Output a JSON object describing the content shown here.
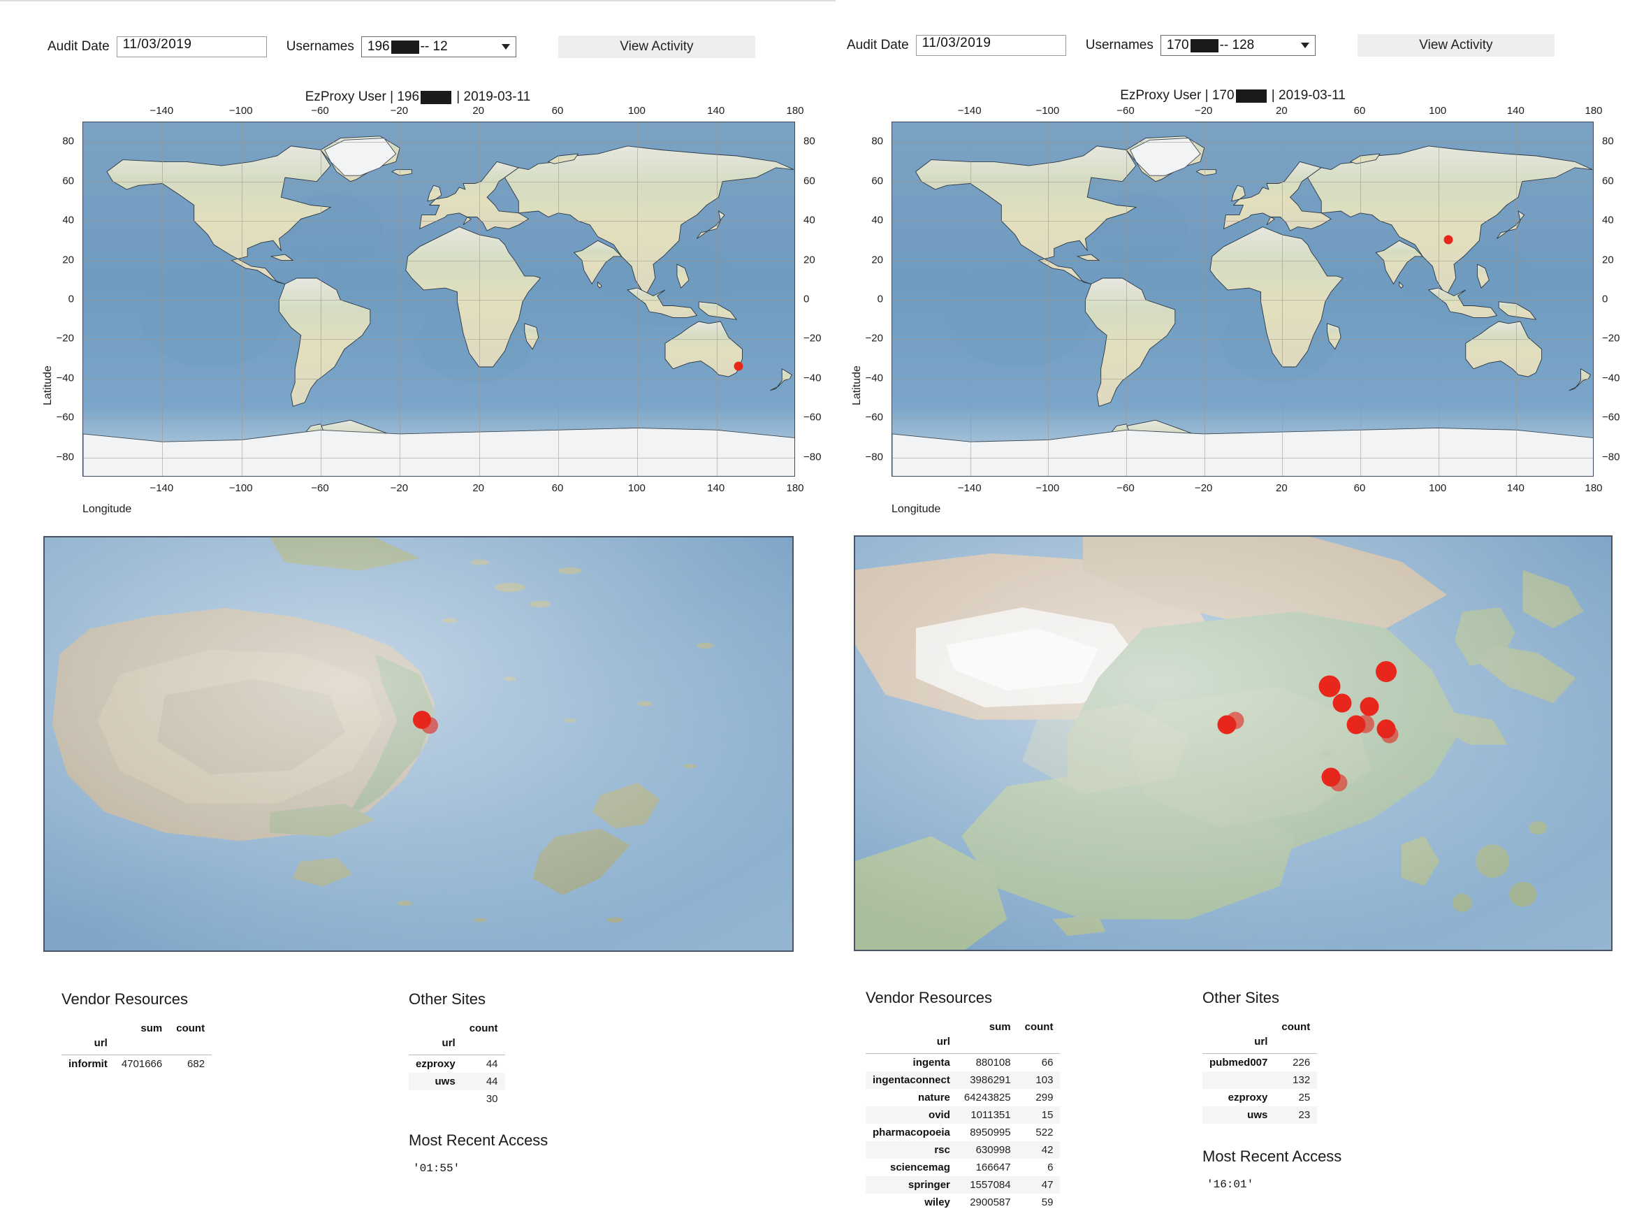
{
  "panels": [
    {
      "id": "left",
      "controls": {
        "audit_date_label": "Audit Date",
        "audit_date_value": "11/03/2019",
        "usernames_label": "Usernames",
        "username_prefix": "196",
        "username_suffix": " -- 12",
        "view_activity_label": "View Activity"
      },
      "plot_title": {
        "prefix": "EzProxy User | 196",
        "suffix": " | 2019-03-11"
      },
      "axes": {
        "xlabel": "Longitude",
        "ylabel": "Latitude",
        "xticks": [
          -140,
          -100,
          -60,
          -20,
          20,
          60,
          100,
          140,
          180
        ],
        "yticks": [
          80,
          60,
          40,
          20,
          0,
          -20,
          -40,
          -60,
          -80
        ],
        "xlim": [
          -180,
          180
        ],
        "ylim": [
          -90,
          90
        ]
      },
      "world_markers": [
        {
          "lon": 151.2,
          "lat": -33.8,
          "size": 13
        }
      ],
      "detail_markers": [
        {
          "x": 0.503,
          "y": 0.438,
          "size": 26,
          "soft": false
        },
        {
          "x": 0.513,
          "y": 0.452,
          "size": 24,
          "soft": true
        }
      ],
      "vendor": {
        "title": "Vendor Resources",
        "index_name": "url",
        "columns": [
          "sum",
          "count"
        ],
        "rows": [
          {
            "url": "informit",
            "sum": "4701666",
            "count": "682"
          }
        ]
      },
      "other": {
        "title": "Other Sites",
        "index_name": "url",
        "columns": [
          "count"
        ],
        "rows": [
          {
            "url": "ezproxy",
            "count": "44"
          },
          {
            "url": "uws",
            "count": "44"
          },
          {
            "url": "",
            "count": "30"
          }
        ]
      },
      "recent": {
        "title": "Most Recent Access",
        "value": "'01:55'"
      }
    },
    {
      "id": "right",
      "controls": {
        "audit_date_label": "Audit Date",
        "audit_date_value": "11/03/2019",
        "usernames_label": "Usernames",
        "username_prefix": "170",
        "username_suffix": " -- 128",
        "view_activity_label": "View Activity"
      },
      "plot_title": {
        "prefix": "EzProxy User | 170",
        "suffix": " | 2019-03-11"
      },
      "axes": {
        "xlabel": "Longitude",
        "ylabel": "Latitude",
        "xticks": [
          -140,
          -100,
          -60,
          -20,
          20,
          60,
          100,
          140,
          180
        ],
        "yticks": [
          80,
          60,
          40,
          20,
          0,
          -20,
          -40,
          -60,
          -80
        ],
        "xlim": [
          -180,
          180
        ],
        "ylim": [
          -90,
          90
        ]
      },
      "world_markers": [
        {
          "lon": 105.0,
          "lat": 30.5,
          "size": 13
        }
      ],
      "detail_markers": [
        {
          "x": 0.7,
          "y": 0.325,
          "size": 30,
          "soft": false
        },
        {
          "x": 0.625,
          "y": 0.36,
          "size": 31,
          "soft": false
        },
        {
          "x": 0.642,
          "y": 0.4,
          "size": 27,
          "soft": false
        },
        {
          "x": 0.678,
          "y": 0.408,
          "size": 27,
          "soft": false
        },
        {
          "x": 0.66,
          "y": 0.452,
          "size": 27,
          "soft": false
        },
        {
          "x": 0.672,
          "y": 0.45,
          "size": 26,
          "soft": true
        },
        {
          "x": 0.7,
          "y": 0.462,
          "size": 27,
          "soft": false
        },
        {
          "x": 0.704,
          "y": 0.476,
          "size": 25,
          "soft": true
        },
        {
          "x": 0.49,
          "y": 0.452,
          "size": 27,
          "soft": false
        },
        {
          "x": 0.501,
          "y": 0.442,
          "size": 25,
          "soft": true
        },
        {
          "x": 0.627,
          "y": 0.578,
          "size": 27,
          "soft": false
        },
        {
          "x": 0.637,
          "y": 0.592,
          "size": 25,
          "soft": true
        }
      ],
      "vendor": {
        "title": "Vendor Resources",
        "index_name": "url",
        "columns": [
          "sum",
          "count"
        ],
        "rows": [
          {
            "url": "ingenta",
            "sum": "880108",
            "count": "66"
          },
          {
            "url": "ingentaconnect",
            "sum": "3986291",
            "count": "103"
          },
          {
            "url": "nature",
            "sum": "64243825",
            "count": "299"
          },
          {
            "url": "ovid",
            "sum": "1011351",
            "count": "15"
          },
          {
            "url": "pharmacopoeia",
            "sum": "8950995",
            "count": "522"
          },
          {
            "url": "rsc",
            "sum": "630998",
            "count": "42"
          },
          {
            "url": "sciencemag",
            "sum": "166647",
            "count": "6"
          },
          {
            "url": "springer",
            "sum": "1557084",
            "count": "47"
          },
          {
            "url": "wiley",
            "sum": "2900587",
            "count": "59"
          }
        ]
      },
      "other": {
        "title": "Other Sites",
        "index_name": "url",
        "columns": [
          "count"
        ],
        "rows": [
          {
            "url": "pubmed007",
            "count": "226"
          },
          {
            "url": "",
            "count": "132"
          },
          {
            "url": "ezproxy",
            "count": "25"
          },
          {
            "url": "uws",
            "count": "23"
          }
        ]
      },
      "recent": {
        "title": "Most Recent Access",
        "value": "'16:01'"
      }
    }
  ],
  "colors": {
    "marker": "#e8261c",
    "ocean": "#7fa5c6",
    "button": "#eeeeee",
    "axis": "#3b4a5a"
  }
}
